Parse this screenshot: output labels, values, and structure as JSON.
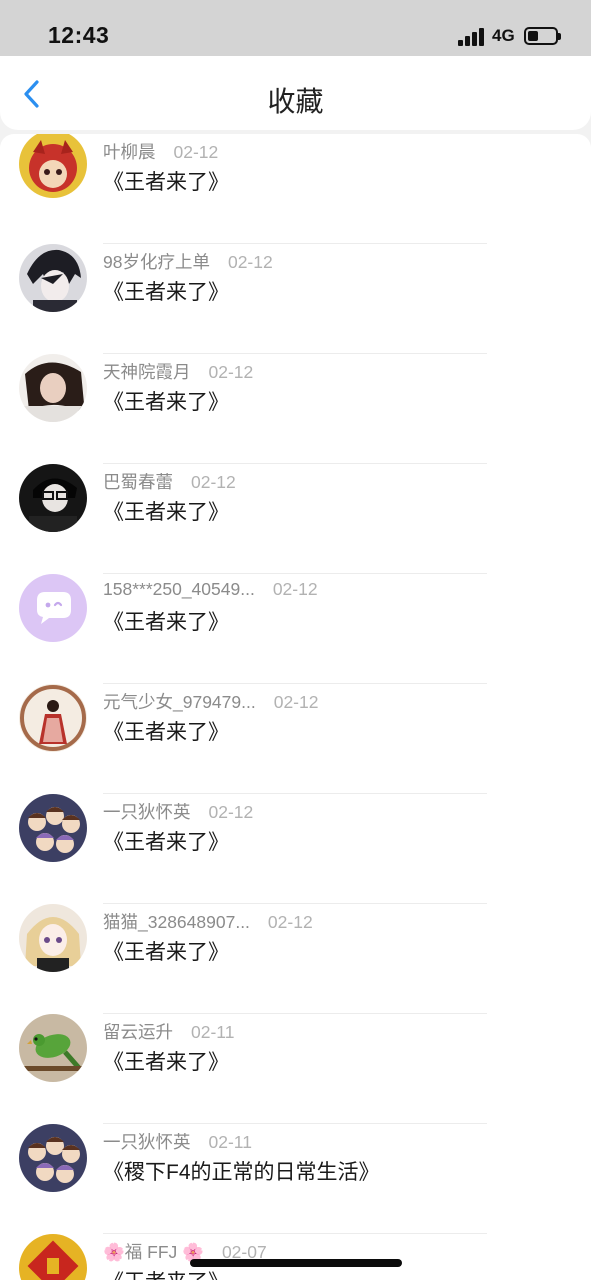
{
  "status_bar": {
    "time": "12:43",
    "network": "4G"
  },
  "nav": {
    "title": "收藏"
  },
  "favorites": [
    {
      "user": "叶柳晨",
      "date": "02-12",
      "title": "《王者来了》",
      "avatar_icon": "red-cartoon-avatar-icon"
    },
    {
      "user": "98岁化疗上单",
      "date": "02-12",
      "title": "《王者来了》",
      "avatar_icon": "anime-boy-avatar-icon"
    },
    {
      "user": "天神院霞月",
      "date": "02-12",
      "title": "《王者来了》",
      "avatar_icon": "photo-girl-avatar-icon"
    },
    {
      "user": "巴蜀春蕾",
      "date": "02-12",
      "title": "《王者来了》",
      "avatar_icon": "glasses-boy-avatar-icon"
    },
    {
      "user": "158***250_40549...",
      "date": "02-12",
      "title": "《王者来了》",
      "avatar_icon": "default-chat-bubble-avatar-icon"
    },
    {
      "user": "元气少女_979479...",
      "date": "02-12",
      "title": "《王者来了》",
      "avatar_icon": "ancient-lady-avatar-icon"
    },
    {
      "user": "一只狄怀英",
      "date": "02-12",
      "title": "《王者来了》",
      "avatar_icon": "chibi-group-avatar-icon"
    },
    {
      "user": "猫猫_328648907...",
      "date": "02-12",
      "title": "《王者来了》",
      "avatar_icon": "anime-girl-avatar-icon"
    },
    {
      "user": "留云运升",
      "date": "02-11",
      "title": "《王者来了》",
      "avatar_icon": "parrot-avatar-icon"
    },
    {
      "user": "一只狄怀英",
      "date": "02-11",
      "title": "《稷下F4的正常的日常生活》",
      "avatar_icon": "chibi-group-avatar-icon"
    },
    {
      "user": "🌸福 FFJ 🌸",
      "date": "02-07",
      "title": "《王者来了》",
      "avatar_icon": "fu-character-avatar-icon"
    }
  ],
  "colors": {
    "accent": "#2b8ff0",
    "default_avatar": "#dcc6f5"
  }
}
